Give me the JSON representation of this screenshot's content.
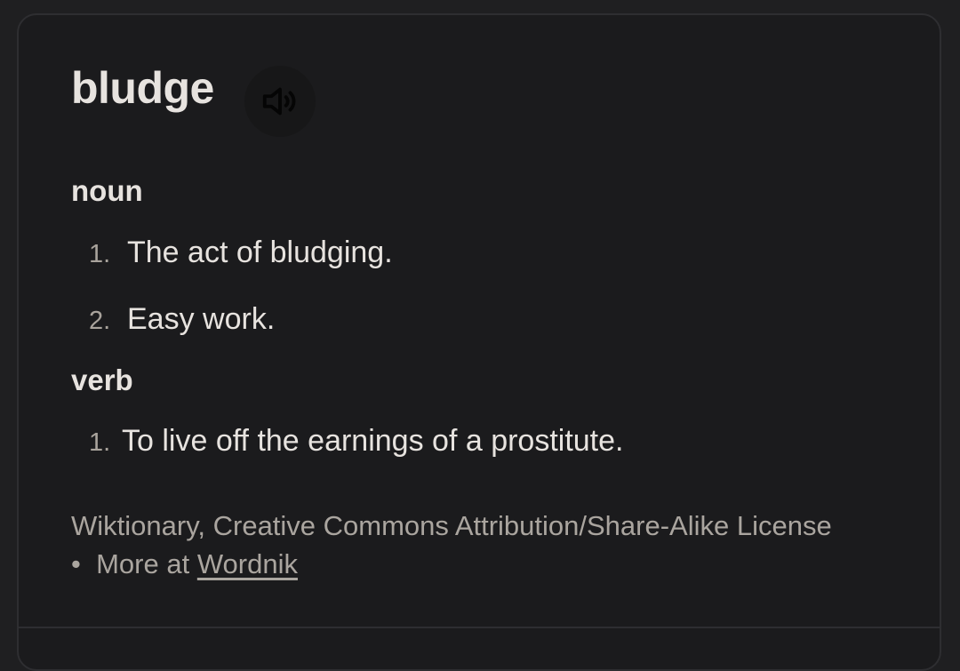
{
  "entry": {
    "word": "bludge",
    "audio_icon": "speaker-icon"
  },
  "senses": [
    {
      "pos": "noun",
      "definitions": [
        {
          "number": "1.",
          "text": "The act of bludging."
        },
        {
          "number": "2.",
          "text": "Easy work."
        }
      ]
    },
    {
      "pos": "verb",
      "definitions": [
        {
          "number": "1.",
          "text": "To live off the earnings of a prostitute."
        }
      ]
    }
  ],
  "attribution": {
    "source_text": "Wiktionary, Creative Commons Attribution/Share-Alike License",
    "separator": "•",
    "more_prefix": "More at",
    "more_link": "Wordnik"
  }
}
